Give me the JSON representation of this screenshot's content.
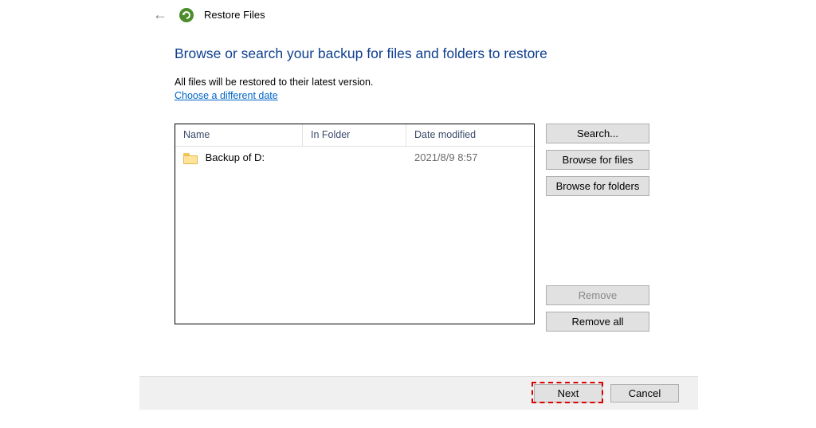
{
  "header": {
    "window_title": "Restore Files"
  },
  "main": {
    "heading": "Browse or search your backup for files and folders to restore",
    "subtext": "All files will be restored to their latest version.",
    "link_date": "Choose a different date"
  },
  "list": {
    "columns": {
      "name": "Name",
      "in_folder": "In Folder",
      "date_modified": "Date modified"
    },
    "rows": [
      {
        "name": "Backup of D:",
        "in_folder": "",
        "date_modified": "2021/8/9 8:57"
      }
    ]
  },
  "side": {
    "search": "Search...",
    "browse_files": "Browse for files",
    "browse_folders": "Browse for folders",
    "remove": "Remove",
    "remove_all": "Remove all"
  },
  "footer": {
    "next": "Next",
    "cancel": "Cancel"
  }
}
